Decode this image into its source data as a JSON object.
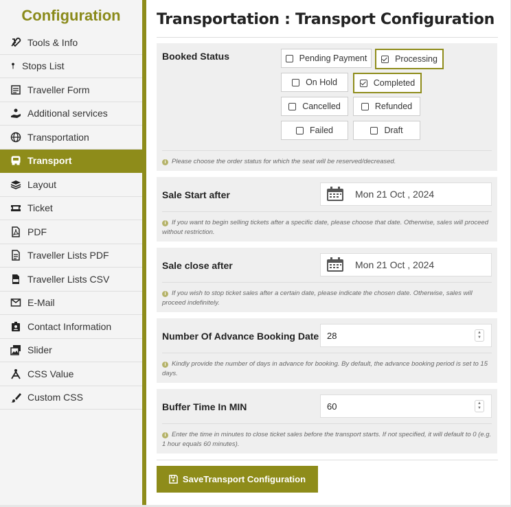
{
  "sidebar": {
    "title": "Configuration",
    "items": [
      {
        "label": "Tools & Info",
        "icon": "tools-icon"
      },
      {
        "label": "Stops List",
        "icon": "pin-icon"
      },
      {
        "label": "Traveller Form",
        "icon": "form-icon"
      },
      {
        "label": "Additional services",
        "icon": "hand-service-icon"
      },
      {
        "label": "Transportation",
        "icon": "globe-icon"
      },
      {
        "label": "Transport",
        "icon": "bus-icon",
        "active": true
      },
      {
        "label": "Layout",
        "icon": "layers-icon"
      },
      {
        "label": "Ticket",
        "icon": "ticket-icon"
      },
      {
        "label": "PDF",
        "icon": "pdf-icon"
      },
      {
        "label": "Traveller Lists PDF",
        "icon": "file-icon"
      },
      {
        "label": "Traveller Lists CSV",
        "icon": "csv-icon"
      },
      {
        "label": "E-Mail",
        "icon": "envelope-icon"
      },
      {
        "label": "Contact Information",
        "icon": "contact-icon"
      },
      {
        "label": "Slider",
        "icon": "images-icon"
      },
      {
        "label": "CSS Value",
        "icon": "css-icon"
      },
      {
        "label": "Custom CSS",
        "icon": "brush-icon"
      }
    ]
  },
  "main": {
    "title": "Transportation : Transport Configuration",
    "booked_status": {
      "label": "Booked Status",
      "options": [
        {
          "label": "Pending Payment",
          "checked": false
        },
        {
          "label": "Processing",
          "checked": true
        },
        {
          "label": "On Hold",
          "checked": false
        },
        {
          "label": "Completed",
          "checked": true
        },
        {
          "label": "Cancelled",
          "checked": false
        },
        {
          "label": "Refunded",
          "checked": false
        },
        {
          "label": "Failed",
          "checked": false
        },
        {
          "label": "Draft",
          "checked": false
        }
      ],
      "hint": "Please choose the order status for which the seat will be reserved/decreased."
    },
    "sale_start": {
      "label": "Sale Start after",
      "value": "Mon 21 Oct , 2024",
      "hint": "If you want to begin selling tickets after a specific date, please choose that date. Otherwise, sales will proceed without restriction."
    },
    "sale_close": {
      "label": "Sale close after",
      "value": "Mon 21 Oct , 2024",
      "hint": "If you wish to stop ticket sales after a certain date, please indicate the chosen date. Otherwise, sales will proceed indefinitely."
    },
    "advance_booking": {
      "label": "Number Of Advance Booking Date",
      "value": "28",
      "hint": "Kindly provide the number of days in advance for booking. By default, the advance booking period is set to 15 days."
    },
    "buffer_time": {
      "label": "Buffer Time In MIN",
      "value": "60",
      "hint": "Enter the time in minutes to close ticket sales before the transport starts. If not specified, it will default to 0 (e.g. 1 hour equals 60 minutes)."
    },
    "save_label": "SaveTransport Configuration"
  },
  "colors": {
    "accent": "#8e8c1a",
    "title": "#8a8a1a",
    "panel": "#efefef"
  }
}
